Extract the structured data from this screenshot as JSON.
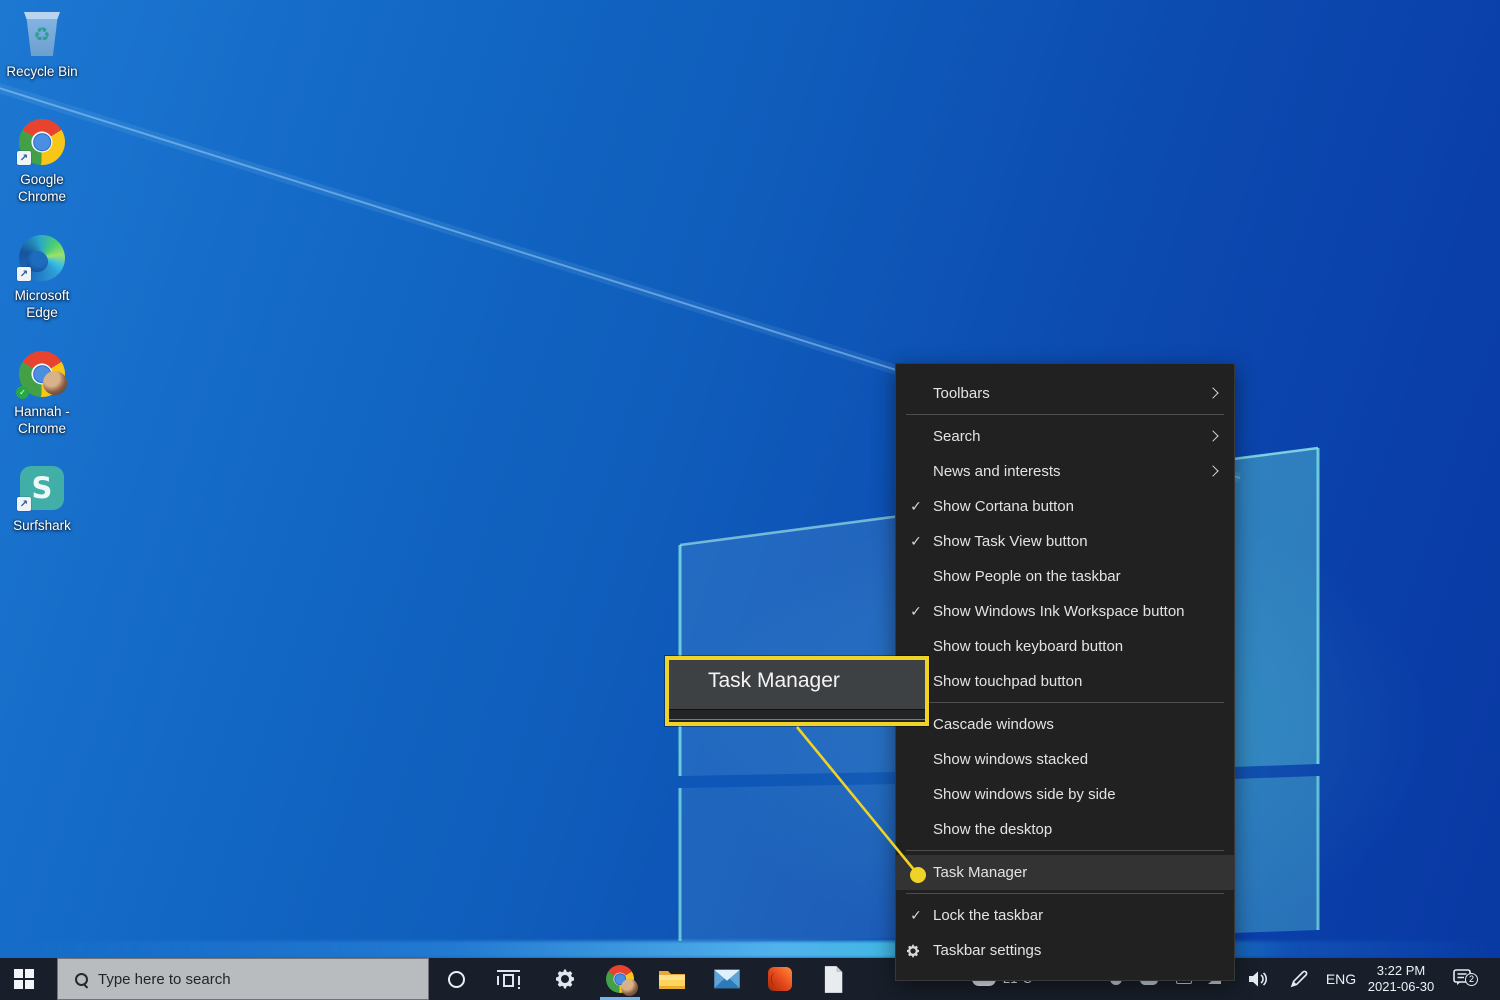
{
  "desktop": {
    "icons": [
      {
        "label": "Recycle Bin"
      },
      {
        "label": "Google Chrome"
      },
      {
        "label": "Microsoft Edge"
      },
      {
        "label": "Hannah - Chrome"
      },
      {
        "label": "Surfshark"
      }
    ]
  },
  "callout": {
    "label": "Task Manager",
    "accent_color": "#F0D327"
  },
  "context_menu": {
    "items": [
      {
        "label": "Toolbars",
        "submenu_arrow": true
      },
      {
        "label": "Search",
        "submenu_arrow": true
      },
      {
        "label": "News and interests",
        "submenu_arrow": true
      },
      {
        "label": "Show Cortana button",
        "checked": true
      },
      {
        "label": "Show Task View button",
        "checked": true
      },
      {
        "label": "Show People on the taskbar",
        "checked": false
      },
      {
        "label": "Show Windows Ink Workspace button",
        "checked": true
      },
      {
        "label": "Show touch keyboard button",
        "checked": false
      },
      {
        "label": "Show touchpad button",
        "checked": false
      },
      {
        "label": "Cascade windows"
      },
      {
        "label": "Show windows stacked"
      },
      {
        "label": "Show windows side by side"
      },
      {
        "label": "Show the desktop"
      },
      {
        "label": "Task Manager",
        "highlighted": true
      },
      {
        "label": "Lock the taskbar",
        "checked": true
      },
      {
        "label": "Taskbar settings",
        "gear_icon": true
      }
    ],
    "background_color": "#212121",
    "highlight_color": "#333333"
  },
  "taskbar": {
    "background_color": "#181f2a",
    "search": {
      "placeholder": "Type here to search"
    },
    "pinned_icons": [
      "start",
      "cortana",
      "task-view",
      "settings",
      "chrome",
      "file-explorer",
      "mail",
      "office",
      "document"
    ],
    "tray": {
      "weather_temp": "21°C",
      "language": "ENG",
      "time": "3:22 PM",
      "date": "2021-06-30",
      "notification_count": "2"
    }
  }
}
